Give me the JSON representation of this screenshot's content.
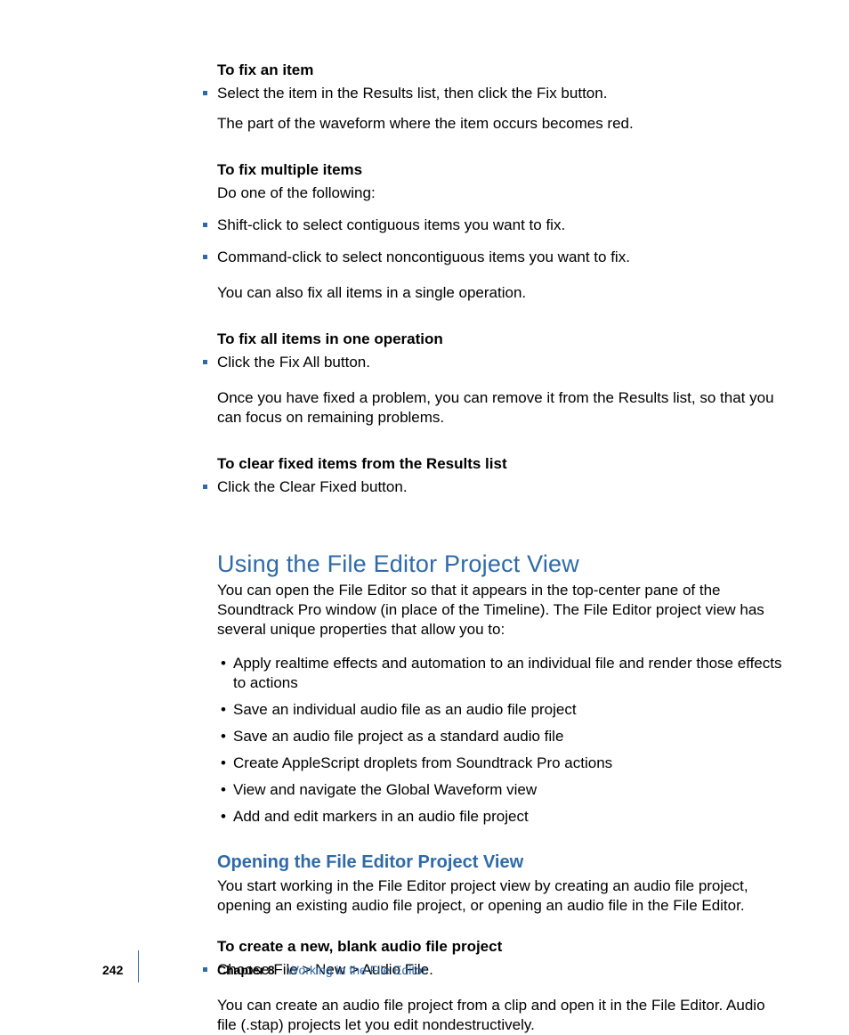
{
  "sec1": {
    "h": "To fix an item",
    "b1": "Select the item in the Results list, then click the Fix button.",
    "p1": "The part of the waveform where the item occurs becomes red."
  },
  "sec2": {
    "h": "To fix multiple items",
    "lead": "Do one of the following:",
    "b1": "Shift-click to select contiguous items you want to fix.",
    "b2": "Command-click to select noncontiguous items you want to fix.",
    "p1": "You can also fix all items in a single operation."
  },
  "sec3": {
    "h": "To fix all items in one operation",
    "b1": "Click the Fix All button.",
    "p1": "Once you have fixed a problem, you can remove it from the Results list, so that you can focus on remaining problems."
  },
  "sec4": {
    "h": "To clear fixed items from the Results list",
    "b1": "Click the Clear Fixed button."
  },
  "h1": "Using the File Editor Project View",
  "h1p": "You can open the File Editor so that it appears in the top-center pane of the Soundtrack Pro window (in place of the Timeline). The File Editor project view has several unique properties that allow you to:",
  "dots": [
    "Apply realtime effects and automation to an individual file and render those effects to actions",
    "Save an individual audio file as an audio file project",
    "Save an audio file project as a standard audio file",
    "Create AppleScript droplets from Soundtrack Pro actions",
    "View and navigate the Global Waveform view",
    "Add and edit markers in an audio file project"
  ],
  "h2": "Opening the File Editor Project View",
  "h2p": "You start working in the File Editor project view by creating an audio file project, opening an existing audio file project, or opening an audio file in the File Editor.",
  "sec5": {
    "h": "To create a new, blank audio file project",
    "b1": "Choose File > New > Audio File.",
    "p1": "You can create an audio file project from a clip and open it in the File Editor. Audio file (.stap) projects let you edit nondestructively."
  },
  "footer": {
    "page": "242",
    "chapter": "Chapter 8",
    "title": "Working in the File Editor"
  }
}
